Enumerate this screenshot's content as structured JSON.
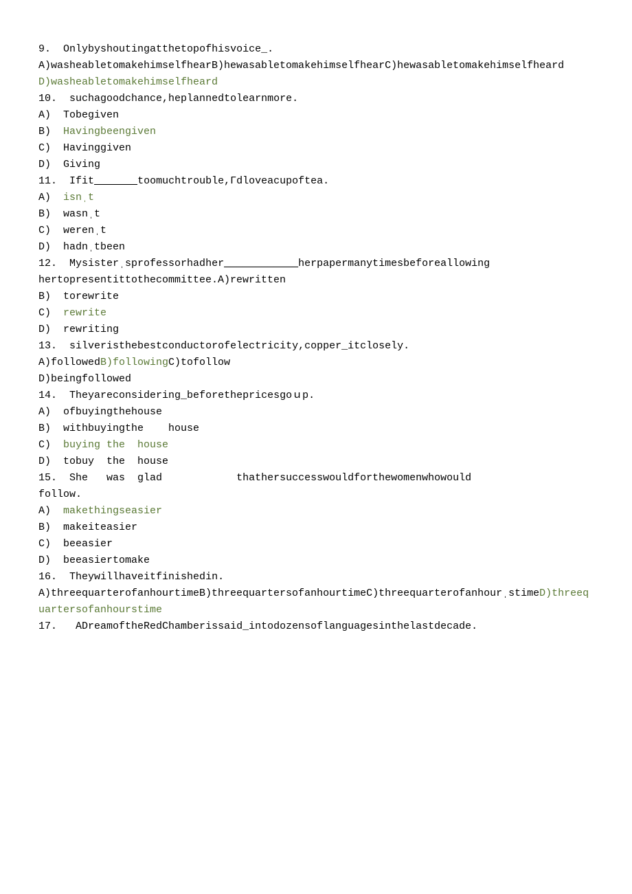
{
  "colors": {
    "answer": "#5a7935",
    "text": "#000000"
  },
  "q9": {
    "num": "9.",
    "stem": "Onlybyshoutingatthetopofhisvoice_.",
    "inlineA": "A)washeabletomakehimselfhearB)hewasabletomakehimselfhearC)hewasabletomakehimselfheard",
    "inlineB": "D)washeabletomakehimselfheard"
  },
  "q10": {
    "num": "10.",
    "stem": "suchagoodchance,heplannedtolearnmore.",
    "A": "Tobegiven",
    "B": "Havingbeengiven",
    "C": "Havinggiven",
    "D": "Giving"
  },
  "q11": {
    "num": "11.",
    "stem_a": "Ifit",
    "blank": "_______",
    "stem_b": "toomuchtrouble,Γdloveacupoftea.",
    "A": "isnˌt",
    "B": "wasnˌt",
    "C": "werenˌt",
    "D": "hadnˌtbeen"
  },
  "q12": {
    "num": "12.",
    "stem_a": "Mysisterˌsprofessorhadher",
    "blank": "____________",
    "stem_b": "herpapermanytimesbeforeallowing",
    "stem_c": "hertopresentittothecommittee.A)rewritten",
    "B": "torewrite",
    "C": "rewrite",
    "D": "rewriting"
  },
  "q13": {
    "num": "13.",
    "stem": "silveristhebestconductorofelectricity,copper_itclosely.",
    "inlineA": "A)followed",
    "inlineB": "B)following",
    "inlineC": "C)tofollow",
    "inlineD": "D)beingfollowed"
  },
  "q14": {
    "num": "14.",
    "stem": "Theyareconsidering_beforethepricesgoｕp.",
    "A": "ofbuyingthehouse",
    "B": "withbuyingthe    house",
    "C": "buying the  house",
    "D": "tobuy  the  house"
  },
  "q15": {
    "num": "15.",
    "stem_a": "She   was  glad            thathersuccesswouldforthewomenwhowould",
    "stem_b": "follow.",
    "A": "makethingseasier",
    "B": "makeiteasier",
    "C": "beeasier",
    "D": "beeasiertomake"
  },
  "q16": {
    "num": "16.",
    "stem": "Theywillhaveitfinishedin.",
    "inlineA": "A)threequarterofanhourtimeB)threequartersofanhourtimeC)threequarterofanhourˌstime",
    "inlineB": "D)threequartersofanhourstime"
  },
  "q17": {
    "num": "17.",
    "stem": " ADreamoftheRedChamberissaid_intodozensoflanguagesinthelastdecade."
  },
  "labels": {
    "A": "A)",
    "B": "B)",
    "C": "C)",
    "D": "D)"
  }
}
